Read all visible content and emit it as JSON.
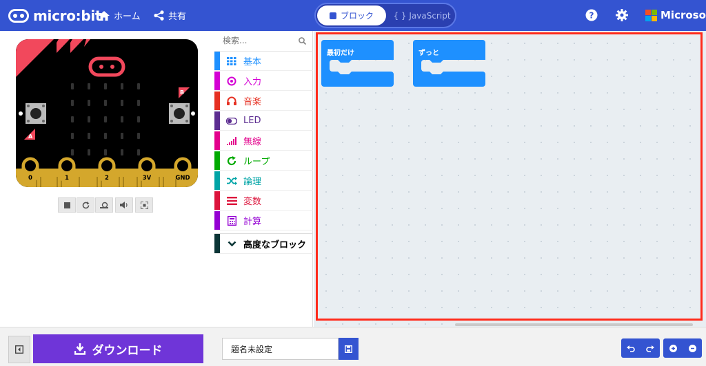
{
  "header": {
    "logo_text": "micro:bit",
    "home_label": "ホーム",
    "share_label": "共有",
    "mode_blocks_label": "ブロック",
    "mode_js_label": "{ } JavaScript",
    "microsoft_label": "Microsoft"
  },
  "simulator": {
    "pins": [
      "0",
      "1",
      "2",
      "3V",
      "GND"
    ],
    "button_a": "A",
    "button_b": "B"
  },
  "toolbox": {
    "search_placeholder": "検索...",
    "categories": [
      {
        "label": "基本",
        "color": "#1e90ff",
        "icon": "grid-icon"
      },
      {
        "label": "入力",
        "color": "#d400d4",
        "icon": "target-icon"
      },
      {
        "label": "音楽",
        "color": "#e63022",
        "icon": "headphones-icon"
      },
      {
        "label": "LED",
        "color": "#5c2d91",
        "icon": "toggle-icon"
      },
      {
        "label": "無線",
        "color": "#e3008c",
        "icon": "signal-icon"
      },
      {
        "label": "ループ",
        "color": "#00aa00",
        "icon": "refresh-icon"
      },
      {
        "label": "論理",
        "color": "#00a4a6",
        "icon": "shuffle-icon"
      },
      {
        "label": "変数",
        "color": "#dc143c",
        "icon": "lines-icon"
      },
      {
        "label": "計算",
        "color": "#9400d3",
        "icon": "calculator-icon"
      }
    ],
    "advanced_label": "高度なブロック",
    "advanced_color": "#0b3536"
  },
  "workspace": {
    "block_on_start": "最初だけ",
    "block_forever": "ずっと",
    "block_color": "#1e90ff"
  },
  "footer": {
    "download_label": "ダウンロード",
    "project_name": "題名未設定"
  }
}
